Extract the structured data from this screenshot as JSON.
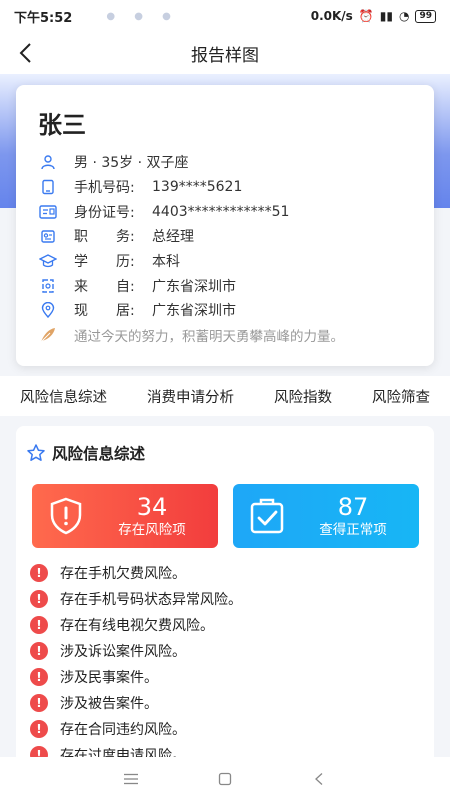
{
  "status_bar": {
    "time": "下午5:52",
    "network_speed": "0.0K/s",
    "battery": "99"
  },
  "navbar": {
    "title": "报告样图",
    "back_icon": "chevron-left-icon"
  },
  "profile": {
    "name": "张三",
    "basic": "男 · 35岁 · 双子座",
    "fields": [
      {
        "label": "手机号码:",
        "value": "139****5621",
        "icon": "phone-icon"
      },
      {
        "label": "身份证号:",
        "value": "4403************51",
        "icon": "id-card-icon"
      },
      {
        "label": "职　　务:",
        "value": "总经理",
        "icon": "briefcase-icon"
      },
      {
        "label": "学　　历:",
        "value": "本科",
        "icon": "graduation-cap-icon"
      },
      {
        "label": "来　　自:",
        "value": "广东省深圳市",
        "icon": "origin-icon"
      },
      {
        "label": "现　　居:",
        "value": "广东省深圳市",
        "icon": "location-pin-icon"
      }
    ],
    "motto": "通过今天的努力，积蓄明天勇攀高峰的力量。"
  },
  "tabs": [
    "风险信息综述",
    "消费申请分析",
    "风险指数",
    "风险筛查"
  ],
  "summary": {
    "title": "风险信息综述",
    "risk_count": "34",
    "risk_label": "存在风险项",
    "normal_count": "87",
    "normal_label": "查得正常项",
    "items": [
      "存在手机欠费风险。",
      "存在手机号码状态异常风险。",
      "存在有线电视欠费风险。",
      "涉及诉讼案件风险。",
      "涉及民事案件。",
      "涉及被告案件。",
      "存在合同违约风险。",
      "存在过度申请风险。"
    ]
  },
  "colors": {
    "accent_blue": "#6584ec",
    "risk_red": "#f23d3d",
    "normal_blue": "#1ea7f7"
  }
}
